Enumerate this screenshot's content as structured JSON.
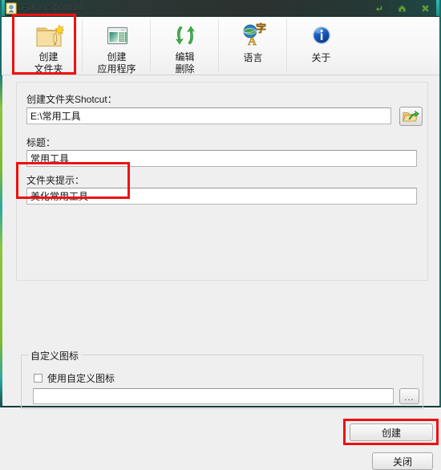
{
  "window": {
    "title": "FolderShortcut",
    "icon": "app-folder-person-icon",
    "buttons": [
      {
        "name": "minimize-button",
        "glyph": "⤺"
      },
      {
        "name": "maximize-button",
        "glyph": "⌂"
      },
      {
        "name": "close-button",
        "glyph": "✖"
      }
    ]
  },
  "toolbar": {
    "items": [
      {
        "icon": "create-folder-icon",
        "line1": "创建",
        "line2": "文件夹",
        "selected": true
      },
      {
        "icon": "create-application-icon",
        "line1": "创建",
        "line2": "应用程序",
        "selected": false
      },
      {
        "icon": "edit-delete-arrows-icon",
        "line1": "编辑",
        "line2": "删除",
        "selected": false
      },
      {
        "icon": "language-globe-icon",
        "line1": "语言",
        "line2": "",
        "selected": false
      },
      {
        "icon": "about-info-icon",
        "line1": "关于",
        "line2": "",
        "selected": false
      }
    ]
  },
  "form": {
    "shortcut_label": "创建文件夹Shotcut：",
    "shortcut_value": "E:\\常用工具",
    "shortcut_placeholder": "",
    "browse_icon": "open-folder-green-arrow-icon",
    "title_label": "标题：",
    "title_value": "常用工具",
    "title_placeholder": "",
    "tip_label": "文件夹提示：",
    "tip_value": "美化常用工具",
    "tip_placeholder": ""
  },
  "custom_icon_group": {
    "title": "自定义图标",
    "checkbox_label": "使用自定义图标",
    "checkbox_checked": false,
    "path_value": "",
    "path_placeholder": "",
    "browse_label": "..."
  },
  "actions": {
    "create_label": "创建",
    "close_label": "关闭"
  },
  "annotations": {
    "highlight_color": "#ee1111",
    "boxes": [
      {
        "name": "highlight-create-folder-tab"
      },
      {
        "name": "highlight-shortcut-field"
      },
      {
        "name": "highlight-create-button"
      }
    ]
  },
  "theme": {
    "titlebar_accent": "#2fb9b0",
    "strip_green": "#8cc63f",
    "strip_teal": "#2aa8a0",
    "panel_bg": "#efefef"
  }
}
